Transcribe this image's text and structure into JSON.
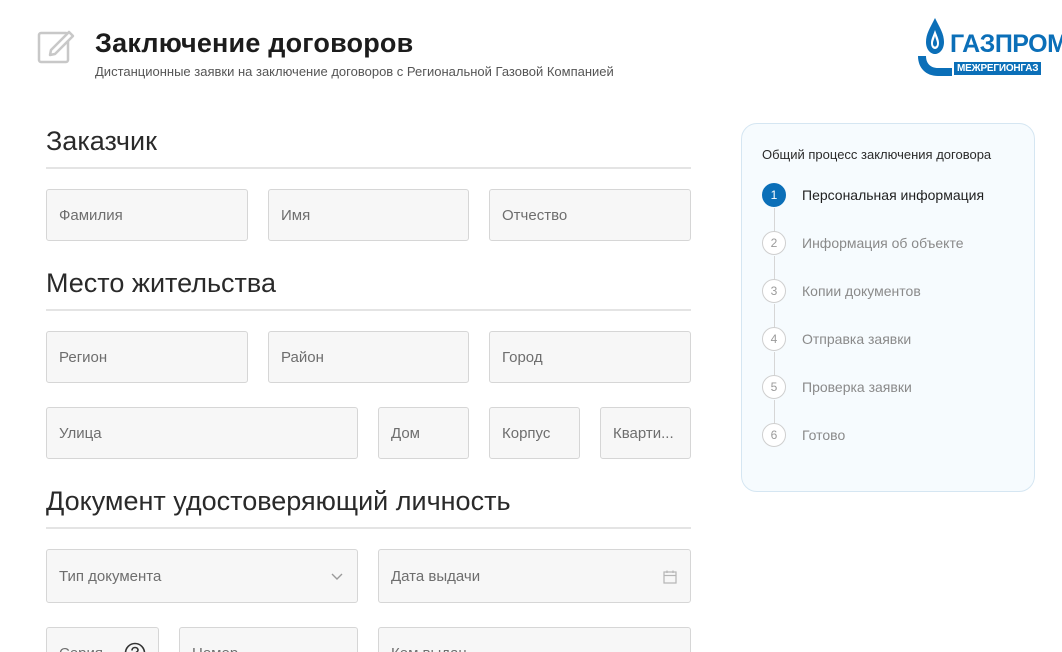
{
  "header": {
    "title": "Заключение договоров",
    "subtitle": "Дистанционные заявки на заключение договоров с Региональной Газовой Компанией",
    "edit_icon": "edit-icon"
  },
  "logo": {
    "main_text": "ГАЗПРОМ",
    "sub_text": "МЕЖРЕГИОНГАЗ",
    "brand_color": "#0b6fb8"
  },
  "sections": {
    "customer": {
      "title": "Заказчик",
      "fields": {
        "last_name": "Фамилия",
        "first_name": "Имя",
        "patronymic": "Отчество"
      }
    },
    "residence": {
      "title": "Место жительства",
      "fields": {
        "region": "Регион",
        "district": "Район",
        "city": "Город",
        "street": "Улица",
        "house": "Дом",
        "building": "Корпус",
        "apartment": "Кварти..."
      }
    },
    "identity_document": {
      "title": "Документ удостоверяющий личность",
      "fields": {
        "document_type": "Тип документа",
        "issue_date": "Дата выдачи",
        "series": "Серия",
        "number": "Номер",
        "issued_by": "Кем выдан"
      }
    }
  },
  "process": {
    "title": "Общий процесс заключения договора",
    "steps": [
      {
        "number": "1",
        "label": "Персональная информация"
      },
      {
        "number": "2",
        "label": "Информация об объекте"
      },
      {
        "number": "3",
        "label": "Копии документов"
      },
      {
        "number": "4",
        "label": "Отправка заявки"
      },
      {
        "number": "5",
        "label": "Проверка заявки"
      },
      {
        "number": "6",
        "label": "Готово"
      }
    ],
    "active_step": 1
  },
  "colors": {
    "accent": "#0b6fb8",
    "field_bg": "#f7f7f7",
    "card_bg": "#f6fbfe"
  }
}
